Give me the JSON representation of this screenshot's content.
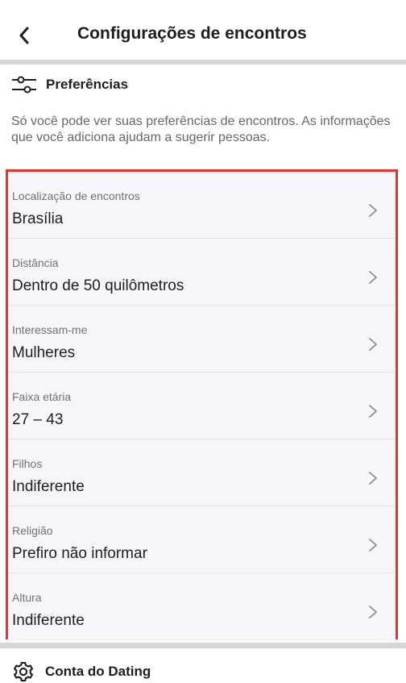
{
  "header": {
    "title": "Configurações de encontros",
    "back_icon": "chevron-left-icon"
  },
  "preferences": {
    "title": "Preferências",
    "icon": "sliders-icon",
    "description": "Só você pode ver suas preferências de encontros. As informações que você adiciona ajudam a sugerir pessoas.",
    "items": [
      {
        "label": "Localização de encontros",
        "value": "Brasília"
      },
      {
        "label": "Distância",
        "value": "Dentro de 50 quilômetros"
      },
      {
        "label": "Interessam-me",
        "value": "Mulheres"
      },
      {
        "label": "Faixa etária",
        "value": "27 – 43"
      },
      {
        "label": "Filhos",
        "value": "Indiferente"
      },
      {
        "label": "Religião",
        "value": "Prefiro não informar"
      },
      {
        "label": "Altura",
        "value": "Indiferente"
      }
    ]
  },
  "dating_account": {
    "title": "Conta do Dating",
    "icon": "gear-icon"
  },
  "colors": {
    "highlight_border": "#e4352a",
    "row_background": "#f6f6f8",
    "divider": "#d6d6d6"
  }
}
